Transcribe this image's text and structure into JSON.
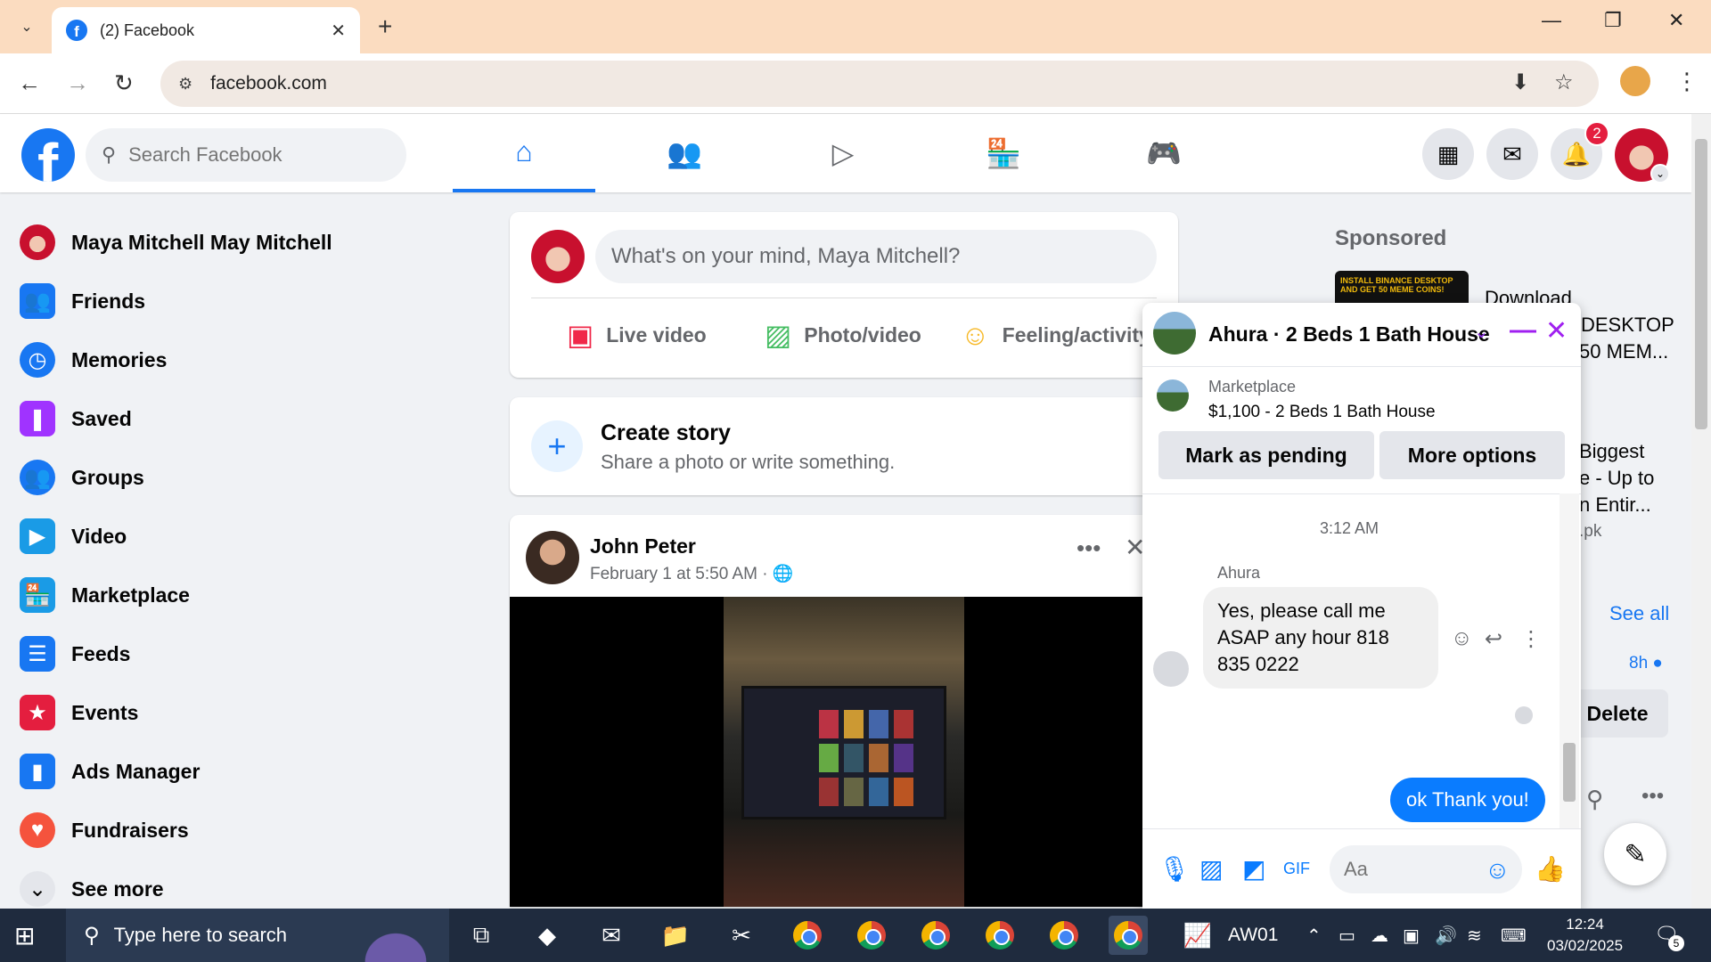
{
  "browser": {
    "tab_title": "(2) Facebook",
    "url": "facebook.com",
    "fb_favicon_letter": "f"
  },
  "fb_header": {
    "logo_letter": "f",
    "search_placeholder": "Search Facebook",
    "notification_count": "2",
    "nav_tabs": [
      "home-icon",
      "friends-icon",
      "watch-icon",
      "marketplace-icon",
      "gaming-icon"
    ]
  },
  "sidebar": {
    "profile_name": "Maya Mitchell May Mitchell",
    "items": [
      {
        "label": "Friends",
        "icon": "friends-icon",
        "color": "#1877f2"
      },
      {
        "label": "Memories",
        "icon": "memories-icon",
        "color": "#1877f2"
      },
      {
        "label": "Saved",
        "icon": "saved-icon",
        "color": "#a033ff"
      },
      {
        "label": "Groups",
        "icon": "groups-icon",
        "color": "#1877f2"
      },
      {
        "label": "Video",
        "icon": "video-icon",
        "color": "#1a9be6"
      },
      {
        "label": "Marketplace",
        "icon": "marketplace-icon",
        "color": "#1a9be6"
      },
      {
        "label": "Feeds",
        "icon": "feeds-icon",
        "color": "#1877f2"
      },
      {
        "label": "Events",
        "icon": "events-icon",
        "color": "#e41e3f"
      },
      {
        "label": "Ads Manager",
        "icon": "ads-manager-icon",
        "color": "#1877f2"
      },
      {
        "label": "Fundraisers",
        "icon": "fundraisers-icon",
        "color": "#f5533d"
      }
    ],
    "see_more": "See more"
  },
  "composer": {
    "placeholder": "What's on your mind, Maya Mitchell?",
    "live_video": "Live video",
    "photo_video": "Photo/video",
    "feeling": "Feeling/activity"
  },
  "story": {
    "title": "Create story",
    "subtitle": "Share a photo or write something."
  },
  "post": {
    "author": "John Peter",
    "date": "February 1 at 5:50 AM · 🌐"
  },
  "right_column": {
    "sponsored": "Sponsored",
    "ad_thumb_text": "INSTALL BINANCE DESKTOP AND GET 50 MEME COINS!",
    "ad_peek_1": "Download",
    "ad_peek_2": "DESKTOP",
    "ad_peek_3": "50 MEM...",
    "ad2_peek_1": "Biggest",
    "ad2_peek_2": "e - Up to",
    "ad2_peek_3": "n Entir...",
    "ad2_peek_4": ".pk",
    "see_all": "See all",
    "time": "8h ●",
    "delete": "Delete"
  },
  "chat": {
    "title": "Ahura · 2 Beds 1 Bath House",
    "marketplace_label": "Marketplace",
    "listing": "$1,100 - 2 Beds 1 Bath House",
    "mark_pending": "Mark as pending",
    "more_options": "More options",
    "timestamp": "3:12 AM",
    "sender": "Ahura",
    "incoming": "Yes, please call me ASAP any hour 818 835 0222",
    "outgoing": "ok Thank you!",
    "input_placeholder": "Aa"
  },
  "taskbar": {
    "search_placeholder": "Type here to search",
    "app_label": "AW01",
    "time": "12:24",
    "date": "03/02/2025",
    "notif_count": "5"
  }
}
